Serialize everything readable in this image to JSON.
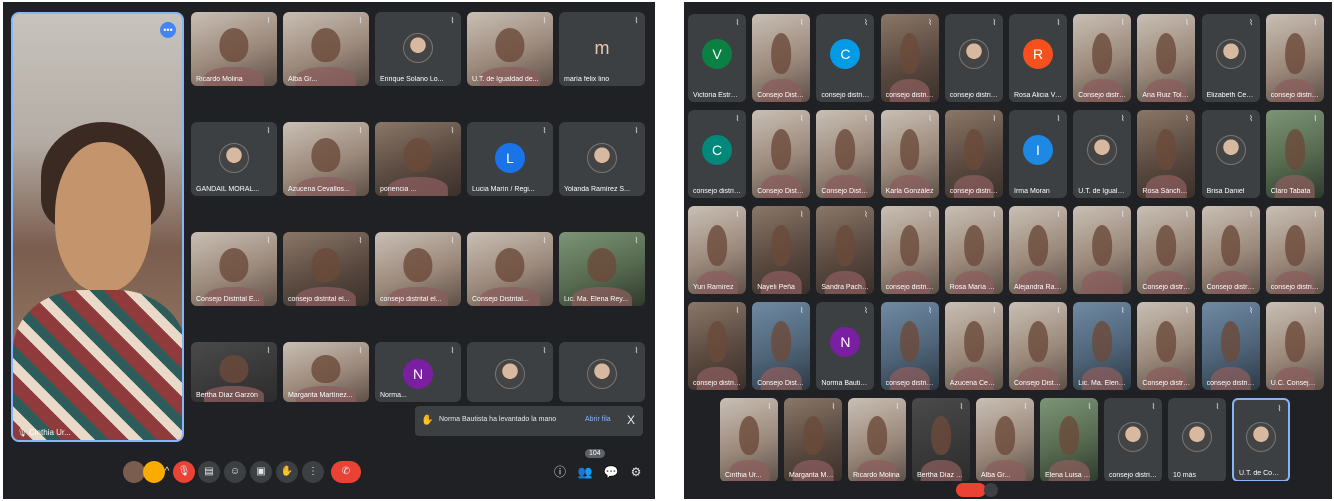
{
  "left": {
    "main_speaker": "Cinthia Ur...",
    "tiles": [
      {
        "name": "Ricardo Molina",
        "kind": "photo",
        "tone": "light"
      },
      {
        "name": "Alba Gr...",
        "kind": "photo",
        "tone": "light"
      },
      {
        "name": "Enrique Solano Lo...",
        "kind": "avatar-img"
      },
      {
        "name": "U.T. de Igualdad de...",
        "kind": "photo",
        "tone": "light"
      },
      {
        "name": "maría felix lino",
        "kind": "letter",
        "letter": "m",
        "color": "#6d4c41"
      },
      {
        "name": "GANDAIL MORAL...",
        "kind": "avatar-img"
      },
      {
        "name": "Azucena Cevallos...",
        "kind": "photo",
        "tone": "light"
      },
      {
        "name": "ponencia ...",
        "kind": "photo"
      },
      {
        "name": "Lucia Marín / Regi...",
        "kind": "letter",
        "letter": "L",
        "color": "#1a73e8"
      },
      {
        "name": "Yolanda Ramírez S...",
        "kind": "avatar-img"
      },
      {
        "name": "Consejo Distrital E...",
        "kind": "photo",
        "tone": "light"
      },
      {
        "name": "consejo distrital el...",
        "kind": "photo"
      },
      {
        "name": "consejo distrital el...",
        "kind": "photo",
        "tone": "light"
      },
      {
        "name": "Consejo Distrital...",
        "kind": "photo",
        "tone": "light"
      },
      {
        "name": "Lic. Ma. Elena Rey...",
        "kind": "photo",
        "tone": "green"
      },
      {
        "name": "Bertha Díaz Garzón",
        "kind": "photo",
        "tone": "dark"
      },
      {
        "name": "Margarita Martínez...",
        "kind": "photo",
        "tone": "light"
      },
      {
        "name": "Norma...",
        "kind": "letter",
        "letter": "N",
        "color": "#7b1fa2"
      },
      {
        "name": "",
        "kind": "avatar-img"
      },
      {
        "name": "",
        "kind": "avatar-img"
      }
    ],
    "toast": {
      "message": "Norma Bautista ha levantado la mano",
      "action": "Abrir fila",
      "close": "X"
    },
    "participant_count": "104"
  },
  "right": {
    "tiles": [
      {
        "name": "Victoria Estrada",
        "kind": "letter",
        "letter": "V",
        "color": "#0b8043"
      },
      {
        "name": "Consejo Distrital Ele...",
        "kind": "photo",
        "tone": "light"
      },
      {
        "name": "consejo distrital ele...",
        "kind": "letter",
        "letter": "C",
        "color": "#039be5"
      },
      {
        "name": "consejo distrital ele...",
        "kind": "photo"
      },
      {
        "name": "consejo distrital ele...",
        "kind": "avatar-img"
      },
      {
        "name": "Rosa Alicia Velázquez",
        "kind": "letter",
        "letter": "R",
        "color": "#f4511e"
      },
      {
        "name": "Consejo distrital ele...",
        "kind": "photo",
        "tone": "light"
      },
      {
        "name": "Ana Ruiz Toledo",
        "kind": "photo",
        "tone": "light"
      },
      {
        "name": "Elizabeth Cervantes...",
        "kind": "avatar-img"
      },
      {
        "name": "consejo distrital...",
        "kind": "photo",
        "tone": "light"
      },
      {
        "name": "consejo distrital ele...",
        "kind": "letter",
        "letter": "C",
        "color": "#00897b"
      },
      {
        "name": "Consejo Distrital Ele...",
        "kind": "photo",
        "tone": "light"
      },
      {
        "name": "Consejo Distrital...",
        "kind": "photo",
        "tone": "light"
      },
      {
        "name": "Karla González",
        "kind": "photo",
        "tone": "light"
      },
      {
        "name": "consejo distrital ele...",
        "kind": "photo"
      },
      {
        "name": "Irma Moran",
        "kind": "letter",
        "letter": "I",
        "color": "#1e88e5"
      },
      {
        "name": "U.T. de Igualdad de...",
        "kind": "avatar-img"
      },
      {
        "name": "Rosa Sánchez López",
        "kind": "photo"
      },
      {
        "name": "Brisa Daniel",
        "kind": "avatar-img"
      },
      {
        "name": "Claro Tabata",
        "kind": "photo",
        "tone": "green"
      },
      {
        "name": "Yuri Ramírez",
        "kind": "photo",
        "tone": "light"
      },
      {
        "name": "Nayeli Peña",
        "kind": "photo"
      },
      {
        "name": "Sandra Pacheco",
        "kind": "photo"
      },
      {
        "name": "consejo distrital ele...",
        "kind": "photo",
        "tone": "light"
      },
      {
        "name": "Rosa María Hernández",
        "kind": "photo",
        "tone": "light"
      },
      {
        "name": "Alejandra Ramos",
        "kind": "photo",
        "tone": "light"
      },
      {
        "name": "",
        "kind": "photo",
        "tone": "light"
      },
      {
        "name": "Consejo distrital ele...",
        "kind": "photo",
        "tone": "light"
      },
      {
        "name": "Consejo distrital ele...",
        "kind": "photo",
        "tone": "light"
      },
      {
        "name": "consejo distrital ele...",
        "kind": "photo",
        "tone": "light"
      },
      {
        "name": "consejo distrital ele...",
        "kind": "photo"
      },
      {
        "name": "Consejo Distrital Ele...",
        "kind": "photo",
        "tone": "blue"
      },
      {
        "name": "Norma Bautista",
        "kind": "letter",
        "letter": "N",
        "color": "#7b1fa2"
      },
      {
        "name": "consejo distrital ele...",
        "kind": "photo",
        "tone": "blue"
      },
      {
        "name": "Azucena Cevallos",
        "kind": "photo",
        "tone": "light"
      },
      {
        "name": "Consejo Distrital Ele...",
        "kind": "photo",
        "tone": "light"
      },
      {
        "name": "Lic. Ma. Elena Reyes...",
        "kind": "photo",
        "tone": "blue"
      },
      {
        "name": "Consejo distrital ele...",
        "kind": "photo",
        "tone": "light"
      },
      {
        "name": "consejo distrital ele...",
        "kind": "photo",
        "tone": "blue"
      },
      {
        "name": "U.C. Consejo Distrital...",
        "kind": "photo",
        "tone": "light"
      },
      {
        "name": "Cinthia Ur...",
        "kind": "photo",
        "tone": "light"
      },
      {
        "name": "Margarita Martínez...",
        "kind": "photo"
      },
      {
        "name": "Ricardo Molina",
        "kind": "photo",
        "tone": "light"
      },
      {
        "name": "Bertha Díaz Garzón",
        "kind": "photo",
        "tone": "dark"
      },
      {
        "name": "Alba Gr...",
        "kind": "photo",
        "tone": "light"
      },
      {
        "name": "Elena Luisa Gómez",
        "kind": "photo",
        "tone": "green"
      },
      {
        "name": "consejo distrital ele...",
        "kind": "avatar-img"
      },
      {
        "name": "10 más",
        "kind": "avatar-img"
      },
      {
        "name": "U.T. de Comunicación...",
        "kind": "avatar-img",
        "selected": true
      }
    ]
  }
}
